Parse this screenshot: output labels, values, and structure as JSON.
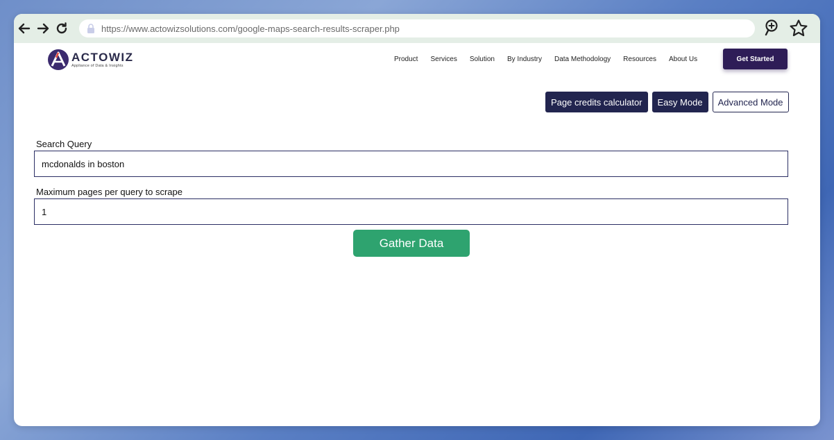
{
  "browser": {
    "url": "https://www.actowizsolutions.com/google-maps-search-results-scraper.php",
    "icons": [
      "back-arrow-icon",
      "forward-arrow-icon",
      "reload-icon",
      "lock-icon",
      "zoom-in-icon",
      "star-icon"
    ]
  },
  "brand": {
    "name": "ACTOWIZ",
    "tagline": "Appliance of Data & Insights",
    "color": "#2e1d57"
  },
  "nav": {
    "items": [
      {
        "label": "Product"
      },
      {
        "label": "Services"
      },
      {
        "label": "Solution"
      },
      {
        "label": "By Industry"
      },
      {
        "label": "Data Methodology"
      },
      {
        "label": "Resources"
      },
      {
        "label": "About Us"
      }
    ],
    "cta": "Get Started"
  },
  "modes": {
    "credits": "Page credits calculator",
    "easy": "Easy Mode",
    "advanced": "Advanced Mode"
  },
  "form": {
    "search_label": "Search Query",
    "search_value": "mcdonalds in boston",
    "pages_label": "Maximum pages per query to scrape",
    "pages_value": "1",
    "submit": "Gather Data"
  },
  "colors": {
    "accent_dark": "#22254f",
    "submit_green": "#2ea36f"
  }
}
